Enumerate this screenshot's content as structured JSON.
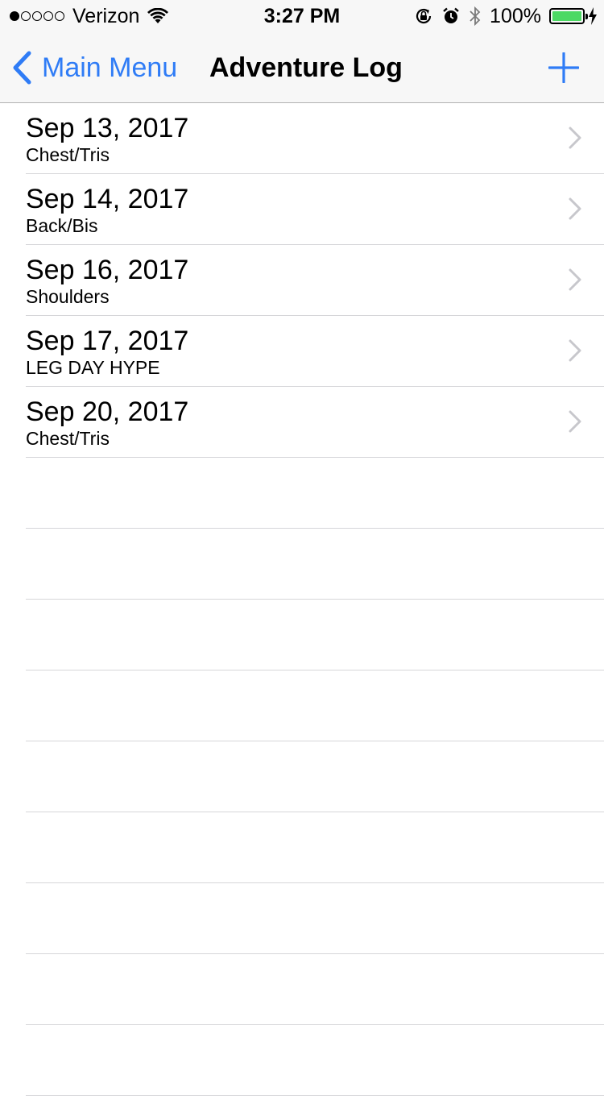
{
  "status_bar": {
    "carrier": "Verizon",
    "time": "3:27 PM",
    "battery_percent": "100%",
    "battery_level": 1.0,
    "signal_dots_filled": 1,
    "signal_dots_total": 5,
    "icons": [
      "wifi-icon",
      "rotation-lock-icon",
      "alarm-icon",
      "bluetooth-icon",
      "battery-icon",
      "charging-icon"
    ]
  },
  "navbar": {
    "back_label": "Main Menu",
    "title": "Adventure Log",
    "add_icon": "plus-icon",
    "accent_color": "#2f7cf6"
  },
  "log_entries": [
    {
      "date": "Sep 13, 2017",
      "workout": "Chest/Tris"
    },
    {
      "date": "Sep 14, 2017",
      "workout": "Back/Bis"
    },
    {
      "date": "Sep 16, 2017",
      "workout": "Shoulders"
    },
    {
      "date": "Sep 17, 2017",
      "workout": "LEG DAY HYPE"
    },
    {
      "date": "Sep 20, 2017",
      "workout": "Chest/Tris"
    }
  ]
}
